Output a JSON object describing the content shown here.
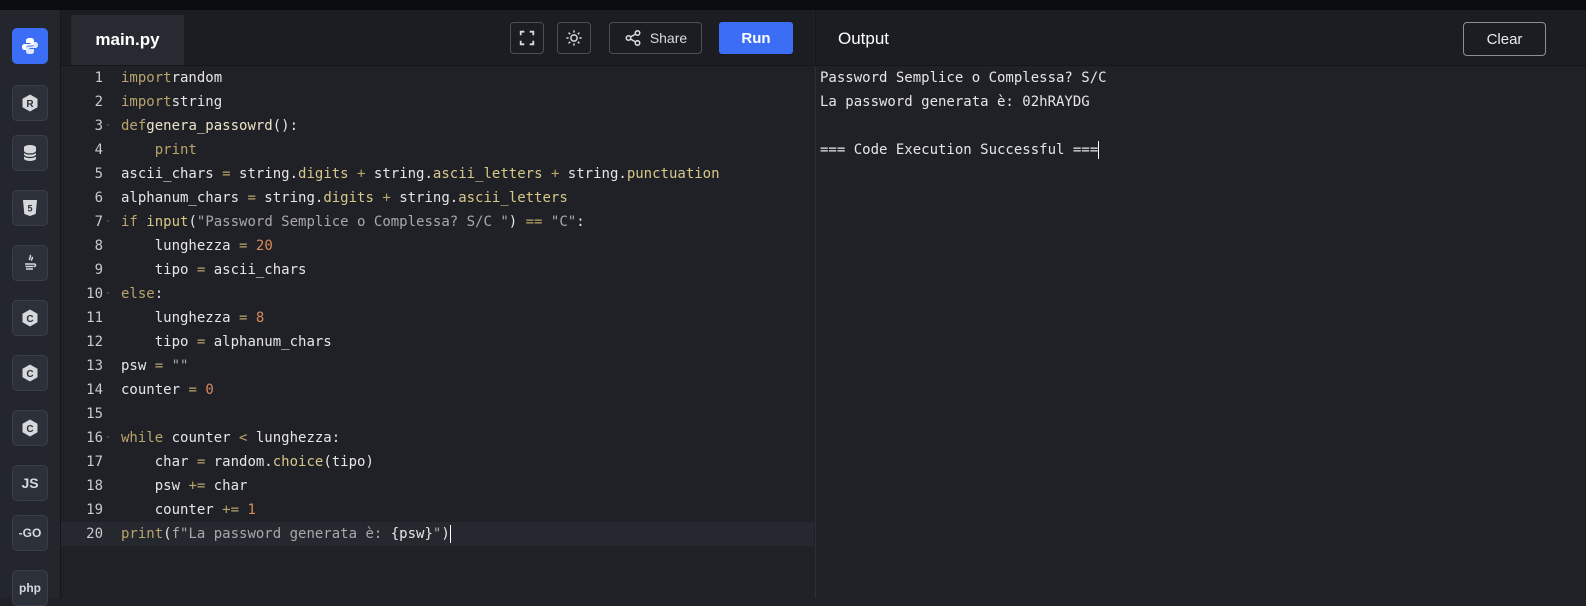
{
  "sidebar": {
    "items": [
      {
        "name": "python-icon",
        "label": "",
        "active": true
      },
      {
        "name": "r-icon",
        "label": "R"
      },
      {
        "name": "database-icon",
        "label": ""
      },
      {
        "name": "html5-icon",
        "label": "5"
      },
      {
        "name": "java-icon",
        "label": ""
      },
      {
        "name": "c-icon",
        "label": "C"
      },
      {
        "name": "cpp-icon",
        "label": "C"
      },
      {
        "name": "csharp-icon",
        "label": "C"
      },
      {
        "name": "js-icon",
        "label": "JS"
      },
      {
        "name": "go-icon",
        "label": "-GO"
      },
      {
        "name": "php-icon",
        "label": "php"
      }
    ]
  },
  "editor": {
    "tab_label": "main.py",
    "share_label": "Share",
    "run_label": "Run",
    "icons": [
      "fullscreen-icon",
      "sun-icon",
      "share-icon"
    ],
    "line_numbers": [
      "1",
      "2",
      "3",
      "4",
      "5",
      "6",
      "7",
      "8",
      "9",
      "10",
      "11",
      "12",
      "13",
      "14",
      "15",
      "16",
      "17",
      "18",
      "19",
      "20"
    ]
  },
  "output": {
    "title": "Output",
    "clear_label": "Clear",
    "lines": [
      "Password Semplice o Complessa? S/C",
      "La password generata è: 02hRAYDG",
      "",
      "=== Code Execution Successful ==="
    ]
  },
  "code_lines": [
    [
      [
        "kw",
        "import"
      ],
      [
        "",
        "random"
      ]
    ],
    [
      [
        "kw",
        "import"
      ],
      [
        "",
        "string"
      ]
    ],
    [
      [
        "kw",
        "def"
      ],
      [
        "fn",
        "genera_passowrd"
      ],
      [
        "",
        "():"
      ]
    ],
    [
      [
        "",
        "    "
      ],
      [
        "kw",
        "print"
      ]
    ],
    [
      [
        "",
        "ascii_chars "
      ],
      [
        "op",
        "="
      ],
      [
        "",
        " string."
      ],
      [
        "at",
        "digits"
      ],
      [
        "",
        " "
      ],
      [
        "op",
        "+"
      ],
      [
        "",
        " string."
      ],
      [
        "at",
        "ascii_letters"
      ],
      [
        "",
        " "
      ],
      [
        "op",
        "+"
      ],
      [
        "",
        " string."
      ],
      [
        "at",
        "punctuation"
      ]
    ],
    [
      [
        "",
        "alphanum_chars "
      ],
      [
        "op",
        "="
      ],
      [
        "",
        " string."
      ],
      [
        "at",
        "digits"
      ],
      [
        "",
        " "
      ],
      [
        "op",
        "+"
      ],
      [
        "",
        " string."
      ],
      [
        "at",
        "ascii_letters"
      ]
    ],
    [
      [
        "kw",
        "if"
      ],
      [
        "",
        " "
      ],
      [
        "at",
        "input"
      ],
      [
        "",
        "("
      ],
      [
        "str",
        "\"Password Semplice o Complessa? S/C \""
      ],
      [
        "",
        ") "
      ],
      [
        "op",
        "=="
      ],
      [
        "",
        " "
      ],
      [
        "str",
        "\"C\""
      ],
      [
        "",
        ":"
      ]
    ],
    [
      [
        "",
        "    lunghezza "
      ],
      [
        "op",
        "="
      ],
      [
        "",
        " "
      ],
      [
        "num",
        "20"
      ]
    ],
    [
      [
        "",
        "    tipo "
      ],
      [
        "op",
        "="
      ],
      [
        "",
        " ascii_chars"
      ]
    ],
    [
      [
        "kw",
        "else"
      ],
      [
        "",
        ":"
      ]
    ],
    [
      [
        "",
        "    lunghezza "
      ],
      [
        "op",
        "="
      ],
      [
        "",
        " "
      ],
      [
        "num",
        "8"
      ]
    ],
    [
      [
        "",
        "    tipo "
      ],
      [
        "op",
        "="
      ],
      [
        "",
        " alphanum_chars"
      ]
    ],
    [
      [
        "",
        "psw "
      ],
      [
        "op",
        "="
      ],
      [
        "",
        " "
      ],
      [
        "str",
        "\"\""
      ]
    ],
    [
      [
        "",
        "counter "
      ],
      [
        "op",
        "="
      ],
      [
        "",
        " "
      ],
      [
        "num",
        "0"
      ]
    ],
    [],
    [
      [
        "kw",
        "while"
      ],
      [
        "",
        " counter "
      ],
      [
        "op",
        "<"
      ],
      [
        "",
        " lunghezza:"
      ]
    ],
    [
      [
        "",
        "    char "
      ],
      [
        "op",
        "="
      ],
      [
        "",
        " random."
      ],
      [
        "at",
        "choice"
      ],
      [
        "",
        "(tipo)"
      ]
    ],
    [
      [
        "",
        "    psw "
      ],
      [
        "op",
        "+="
      ],
      [
        "",
        " char"
      ]
    ],
    [
      [
        "",
        "    counter "
      ],
      [
        "op",
        "+="
      ],
      [
        "",
        " "
      ],
      [
        "num",
        "1"
      ]
    ],
    [
      [
        "kw",
        "print"
      ],
      [
        "",
        "("
      ],
      [
        "str",
        "f\"La password generata è: "
      ],
      [
        "",
        "{psw}"
      ],
      [
        "str",
        "\""
      ],
      [
        "",
        ")"
      ]
    ]
  ]
}
